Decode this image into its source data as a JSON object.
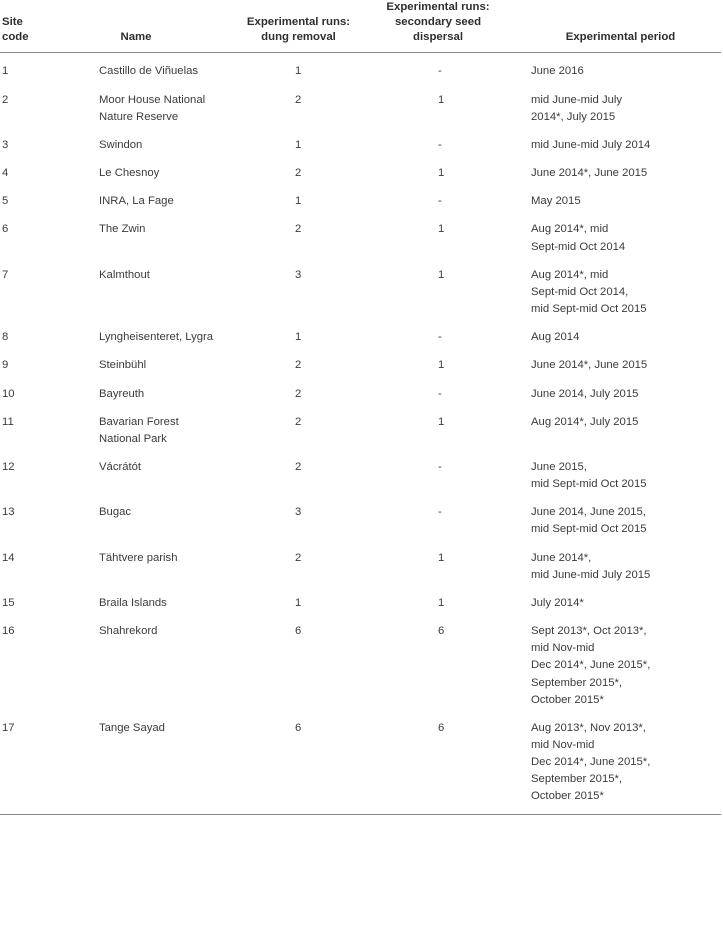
{
  "table": {
    "headers": [
      {
        "id": "site-code",
        "lines": [
          "Site",
          "code"
        ]
      },
      {
        "id": "name",
        "lines": [
          "Name"
        ]
      },
      {
        "id": "runs-dung-removal",
        "lines": [
          "Experimental runs:",
          "dung removal"
        ]
      },
      {
        "id": "runs-secondary-seed-dispersal",
        "lines": [
          "Experimental runs:",
          "secondary seed",
          "dispersal"
        ]
      },
      {
        "id": "experimental-period",
        "lines": [
          "Experimental period"
        ]
      }
    ],
    "rows": [
      {
        "site_code": "1",
        "name": [
          "Castillo de Viñuelas"
        ],
        "dung_removal": "1",
        "secondary_seed_dispersal": "-",
        "period": [
          "June 2016"
        ]
      },
      {
        "site_code": "2",
        "name": [
          "Moor House National",
          "Nature Reserve"
        ],
        "dung_removal": "2",
        "secondary_seed_dispersal": "1",
        "period": [
          "mid June-mid July",
          "2014*, July 2015"
        ]
      },
      {
        "site_code": "3",
        "name": [
          "Swindon"
        ],
        "dung_removal": "1",
        "secondary_seed_dispersal": "-",
        "period": [
          "mid June-mid July 2014"
        ]
      },
      {
        "site_code": "4",
        "name": [
          "Le Chesnoy"
        ],
        "dung_removal": "2",
        "secondary_seed_dispersal": "1",
        "period": [
          "June 2014*, June 2015"
        ]
      },
      {
        "site_code": "5",
        "name": [
          "INRA, La Fage"
        ],
        "dung_removal": "1",
        "secondary_seed_dispersal": "-",
        "period": [
          "May 2015"
        ]
      },
      {
        "site_code": "6",
        "name": [
          "The Zwin"
        ],
        "dung_removal": "2",
        "secondary_seed_dispersal": "1",
        "period": [
          "Aug 2014*, mid",
          "Sept-mid Oct 2014"
        ]
      },
      {
        "site_code": "7",
        "name": [
          "Kalmthout"
        ],
        "dung_removal": "3",
        "secondary_seed_dispersal": "1",
        "period": [
          "Aug 2014*, mid",
          "Sept-mid Oct 2014,",
          "mid Sept-mid Oct 2015"
        ]
      },
      {
        "site_code": "8",
        "name": [
          "Lyngheisenteret, Lygra"
        ],
        "dung_removal": "1",
        "secondary_seed_dispersal": "-",
        "period": [
          "Aug 2014"
        ]
      },
      {
        "site_code": "9",
        "name": [
          "Steinbühl"
        ],
        "dung_removal": "2",
        "secondary_seed_dispersal": "1",
        "period": [
          "June 2014*, June 2015"
        ]
      },
      {
        "site_code": "10",
        "name": [
          "Bayreuth"
        ],
        "dung_removal": "2",
        "secondary_seed_dispersal": "-",
        "period": [
          "June 2014, July 2015"
        ]
      },
      {
        "site_code": "11",
        "name": [
          "Bavarian Forest",
          "National Park"
        ],
        "dung_removal": "2",
        "secondary_seed_dispersal": "1",
        "period": [
          "Aug 2014*, July 2015"
        ]
      },
      {
        "site_code": "12",
        "name": [
          "Vácrátót"
        ],
        "dung_removal": "2",
        "secondary_seed_dispersal": "-",
        "period": [
          "June 2015,",
          "mid Sept-mid Oct 2015"
        ]
      },
      {
        "site_code": "13",
        "name": [
          "Bugac"
        ],
        "dung_removal": "3",
        "secondary_seed_dispersal": "-",
        "period": [
          "June 2014, June 2015,",
          "mid Sept-mid Oct 2015"
        ]
      },
      {
        "site_code": "14",
        "name": [
          "Tähtvere parish"
        ],
        "dung_removal": "2",
        "secondary_seed_dispersal": "1",
        "period": [
          "June 2014*,",
          "mid June-mid July 2015"
        ]
      },
      {
        "site_code": "15",
        "name": [
          "Braila Islands"
        ],
        "dung_removal": "1",
        "secondary_seed_dispersal": "1",
        "period": [
          "July 2014*"
        ]
      },
      {
        "site_code": "16",
        "name": [
          "Shahrekord"
        ],
        "dung_removal": "6",
        "secondary_seed_dispersal": "6",
        "period": [
          "Sept 2013*, Oct 2013*,",
          "mid Nov-mid",
          "Dec 2014*, June 2015*,",
          "September 2015*,",
          "October 2015*"
        ]
      },
      {
        "site_code": "17",
        "name": [
          "Tange Sayad"
        ],
        "dung_removal": "6",
        "secondary_seed_dispersal": "6",
        "period": [
          "Aug 2013*, Nov 2013*,",
          "mid Nov-mid",
          "Dec 2014*, June 2015*,",
          "September 2015*,",
          "October 2015*"
        ]
      }
    ]
  },
  "style": {
    "text_color": "#3b3b3b",
    "header_color": "#2e2e2e",
    "rule_color": "#8a8a8a",
    "background": "#ffffff"
  }
}
